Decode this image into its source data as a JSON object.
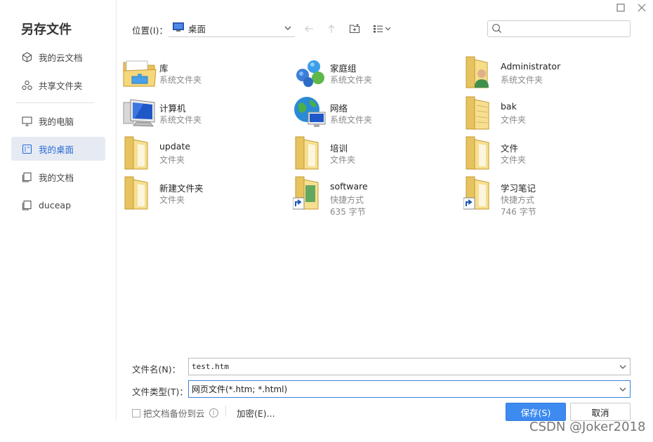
{
  "window": {
    "title": "另存文件"
  },
  "sidebar": {
    "items": [
      {
        "label": "我的云文档"
      },
      {
        "label": "共享文件夹"
      },
      {
        "label": "我的电脑"
      },
      {
        "label": "我的桌面",
        "active": true
      },
      {
        "label": "我的文档"
      },
      {
        "label": "duceap"
      }
    ]
  },
  "toolbar": {
    "location_label": "位置(I)：",
    "location_value": "桌面",
    "search_placeholder": ""
  },
  "files": [
    {
      "name": "库",
      "meta": "系统文件夹",
      "icon": "library-icon"
    },
    {
      "name": "家庭组",
      "meta": "系统文件夹",
      "icon": "homegroup-icon"
    },
    {
      "name": "Administrator",
      "meta": "系统文件夹",
      "icon": "user-folder-icon"
    },
    {
      "name": "计算机",
      "meta": "系统文件夹",
      "icon": "computer-icon"
    },
    {
      "name": "网络",
      "meta": "系统文件夹",
      "icon": "network-icon"
    },
    {
      "name": "bak",
      "meta": "文件夹",
      "icon": "folder-icon"
    },
    {
      "name": "update",
      "meta": "文件夹",
      "icon": "folder-icon"
    },
    {
      "name": "培训",
      "meta": "文件夹",
      "icon": "folder-icon"
    },
    {
      "name": "文件",
      "meta": "文件夹",
      "icon": "folder-icon"
    },
    {
      "name": "新建文件夹",
      "meta": "文件夹",
      "icon": "folder-icon"
    },
    {
      "name": "software",
      "meta": "快捷方式",
      "meta2": "635 字节",
      "icon": "shortcut-folder-icon"
    },
    {
      "name": "学习笔记",
      "meta": "快捷方式",
      "meta2": "746 字节",
      "icon": "shortcut-folder-icon"
    }
  ],
  "form": {
    "filename_label": "文件名(N)：",
    "filename_value": "test.htm",
    "filetype_label": "文件类型(T)：",
    "filetype_value": "网页文件(*.htm; *.html)",
    "backup_label": "把文档备份到云",
    "encrypt_label": "加密(E)...",
    "save_label": "保存(S)",
    "cancel_label": "取消"
  },
  "watermark": "CSDN @Joker2018",
  "colors": {
    "accent": "#3d8af0",
    "active_bg": "#e6ebf3",
    "active_text": "#2a6bd7",
    "folder": "#f3d77a"
  }
}
